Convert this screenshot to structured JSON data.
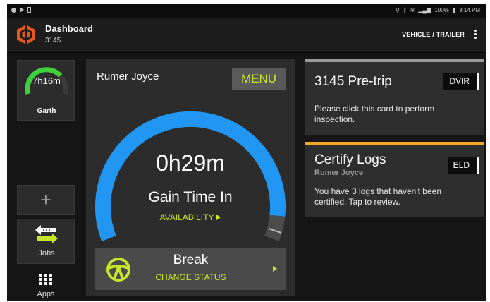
{
  "status_bar": {
    "time": "3:14 PM",
    "battery": "100%",
    "icons": [
      "notification-dot-icon",
      "play-icon",
      "sim-icon",
      "location-icon",
      "bluetooth-icon",
      "wifi-icon",
      "signal-icon",
      "battery-icon"
    ]
  },
  "app_bar": {
    "title": "Dashboard",
    "subtitle": "3145",
    "vehicle_trailer_label": "VEHICLE / TRAILER",
    "logo_icon": "hexagon-logo-icon",
    "overflow_icon": "more-vertical-icon"
  },
  "sidebar": {
    "driver": {
      "time": "7h16m",
      "name": "Garth",
      "gauge_fraction": 0.72
    },
    "add_icon": "plus-icon",
    "jobs": {
      "label": "Jobs",
      "icon": "swap-arrows-icon"
    },
    "apps": {
      "label": "Apps",
      "icon": "grid-icon"
    }
  },
  "clock": {
    "driver_name": "Rumer Joyce",
    "menu_label": "MENU",
    "time": "0h29m",
    "status": "Gain Time In",
    "availability": "AVAILABILITY",
    "gauge_fraction": 0.93,
    "break": {
      "label": "Break",
      "action": "CHANGE STATUS",
      "icon": "steering-wheel-icon"
    }
  },
  "pretrip_card": {
    "title": "3145 Pre-trip",
    "badge": "DVIR",
    "body": "Please click this card to perform inspection."
  },
  "certify_card": {
    "title": "Certify Logs",
    "subtitle": "Rumer Joyce",
    "badge": "ELD",
    "body": "You have 3 logs that haven't been certified. Tap to review."
  },
  "colors": {
    "accent_lime": "#c8e62b",
    "gauge_blue": "#2196f3",
    "gauge_green": "#3fd13a",
    "certify_orange": "#f5a623"
  }
}
